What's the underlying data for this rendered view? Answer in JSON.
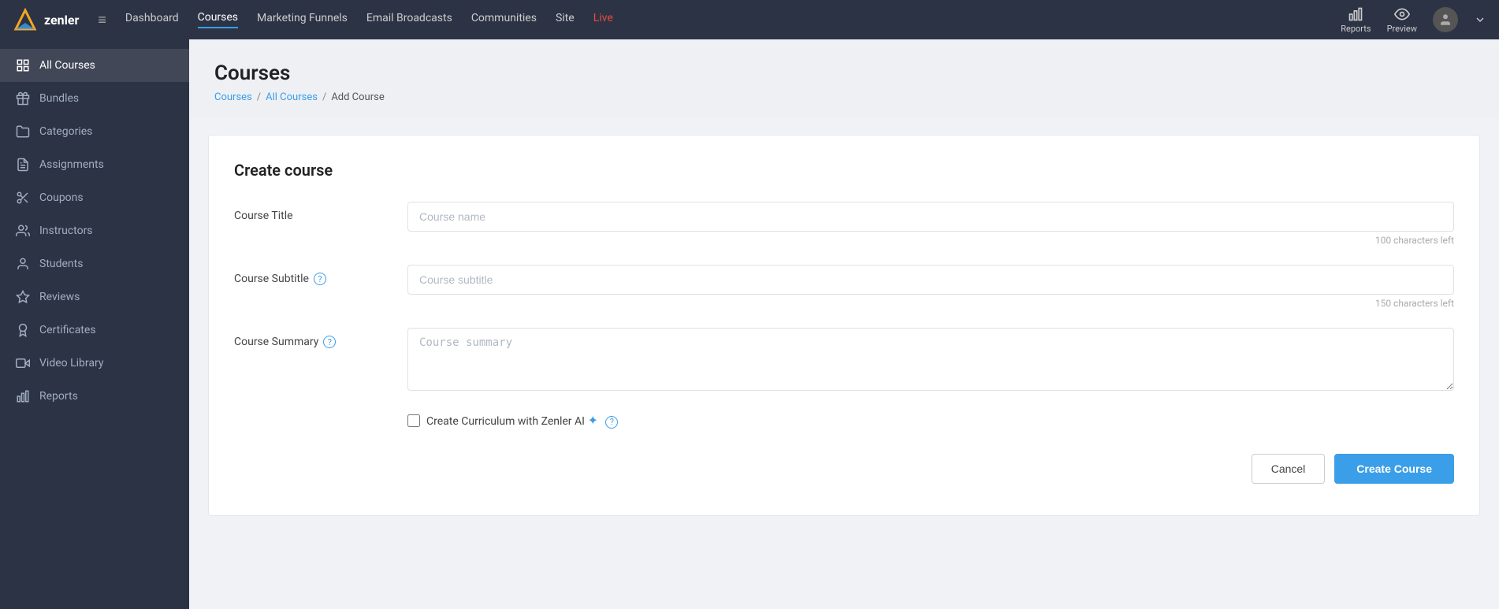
{
  "topnav": {
    "logo_text": "zenler",
    "links": [
      {
        "label": "Dashboard",
        "active": false
      },
      {
        "label": "Courses",
        "active": true
      },
      {
        "label": "Marketing Funnels",
        "active": false
      },
      {
        "label": "Email Broadcasts",
        "active": false
      },
      {
        "label": "Communities",
        "active": false
      },
      {
        "label": "Site",
        "active": false
      },
      {
        "label": "Live",
        "active": false
      }
    ],
    "reports_label": "Reports",
    "preview_label": "Preview",
    "hamburger_icon": "≡"
  },
  "sidebar": {
    "items": [
      {
        "id": "all-courses",
        "label": "All Courses",
        "icon": "grid",
        "active": true
      },
      {
        "id": "bundles",
        "label": "Bundles",
        "icon": "gift",
        "active": false
      },
      {
        "id": "categories",
        "label": "Categories",
        "icon": "folder",
        "active": false
      },
      {
        "id": "assignments",
        "label": "Assignments",
        "icon": "file-text",
        "active": false
      },
      {
        "id": "coupons",
        "label": "Coupons",
        "icon": "scissors",
        "active": false
      },
      {
        "id": "instructors",
        "label": "Instructors",
        "icon": "users",
        "active": false
      },
      {
        "id": "students",
        "label": "Students",
        "icon": "user",
        "active": false
      },
      {
        "id": "reviews",
        "label": "Reviews",
        "icon": "star",
        "active": false
      },
      {
        "id": "certificates",
        "label": "Certificates",
        "icon": "award",
        "active": false
      },
      {
        "id": "video-library",
        "label": "Video Library",
        "icon": "video",
        "active": false
      },
      {
        "id": "reports",
        "label": "Reports",
        "icon": "bar-chart",
        "active": false
      }
    ]
  },
  "page": {
    "title": "Courses",
    "breadcrumb": {
      "links": [
        "Courses",
        "All Courses"
      ],
      "current": "Add Course",
      "separator": "/"
    }
  },
  "form": {
    "title": "Create course",
    "fields": {
      "course_title": {
        "label": "Course Title",
        "placeholder": "Course name",
        "char_count": "100 characters left",
        "value": ""
      },
      "course_subtitle": {
        "label": "Course Subtitle",
        "placeholder": "Course subtitle",
        "char_count": "150 characters left",
        "value": "",
        "has_help": true
      },
      "course_summary": {
        "label": "Course Summary",
        "placeholder": "Course summary",
        "value": "",
        "has_help": true
      }
    },
    "ai_checkbox": {
      "label": "Create Curriculum with Zenler AI",
      "checked": false
    },
    "buttons": {
      "cancel": "Cancel",
      "create": "Create Course"
    }
  }
}
